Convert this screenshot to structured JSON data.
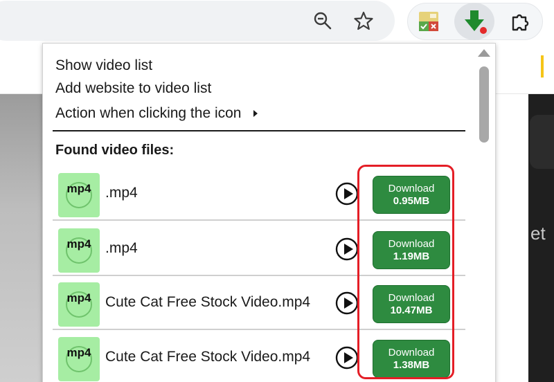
{
  "toolbar": {
    "icons": [
      "zoom-icon",
      "star-icon",
      "extension-icon",
      "video-downloader-icon",
      "puzzle-icon"
    ]
  },
  "popup": {
    "menu": {
      "show_video_list": "Show video list",
      "add_website": "Add website to video list",
      "action_on_click": "Action when clicking the icon"
    },
    "found_title": "Found video files:",
    "badge_label": "mp4",
    "files": [
      {
        "name": ".mp4",
        "download_label": "Download",
        "size": "0.95MB"
      },
      {
        "name": ".mp4",
        "download_label": "Download",
        "size": "1.19MB"
      },
      {
        "name": "Cute Cat Free Stock Video.mp4",
        "download_label": "Download",
        "size": "10.47MB"
      },
      {
        "name": "Cute Cat Free Stock Video.mp4",
        "download_label": "Download",
        "size": "1.38MB"
      }
    ]
  },
  "page": {
    "partial_text": "et"
  },
  "colors": {
    "download_green": "#2e8b40",
    "badge_green": "#a6eda3",
    "highlight_red": "#e41e26",
    "toolbar_bg": "#f0f2f4"
  }
}
